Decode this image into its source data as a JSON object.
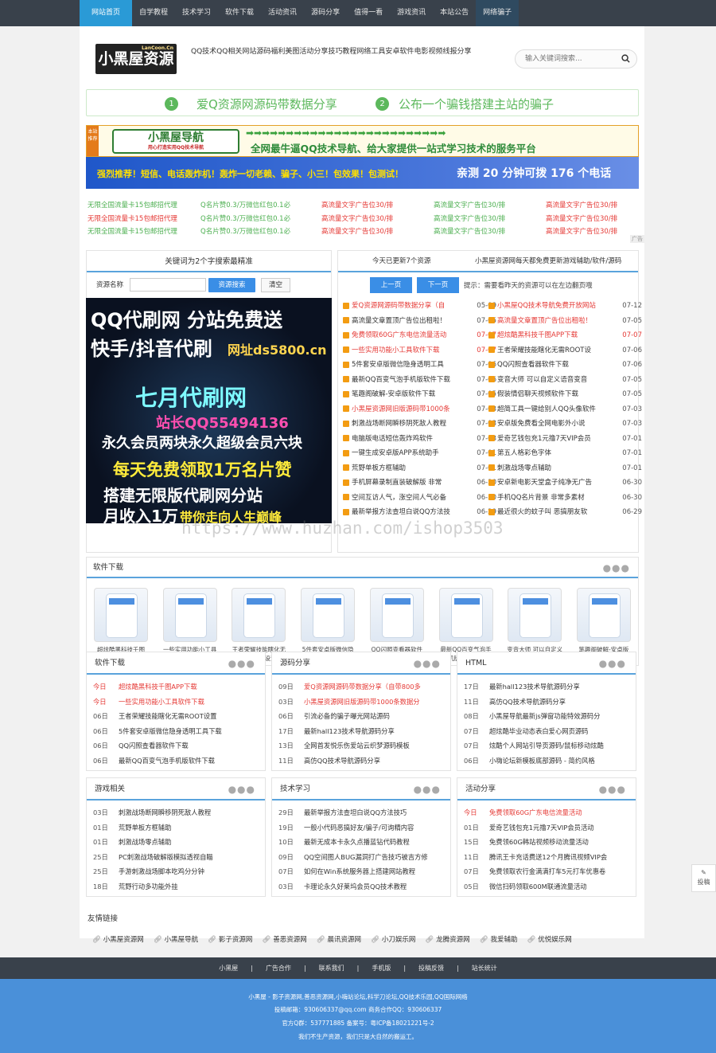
{
  "topnav": [
    {
      "label": "网站首页",
      "active": true
    },
    {
      "label": "自学教程",
      "dropdown": true
    },
    {
      "label": "技术学习",
      "dropdown": true
    },
    {
      "label": "软件下载",
      "dropdown": true
    },
    {
      "label": "活动资讯",
      "dropdown": true
    },
    {
      "label": "源码分享",
      "dropdown": true
    },
    {
      "label": "值得一看",
      "dropdown": true
    },
    {
      "label": "游戏资讯",
      "dropdown": true
    },
    {
      "label": "本站公告"
    },
    {
      "label": "网络骗子",
      "highlight": true
    }
  ],
  "logo": {
    "main": "小黑屋资源站",
    "sub": "LanCoon.Cn"
  },
  "header_links": [
    "QQ技术",
    "QQ相关",
    "网站源码",
    "福利美图",
    "活动分享",
    "技巧教程",
    "网络工具",
    "安卓软件",
    "电影视频",
    "线报分享"
  ],
  "search": {
    "placeholder": "输入关键词搜索..."
  },
  "notice": {
    "n1": "1",
    "t1": "爱Q资源网源码带数据分享",
    "n2": "2",
    "t2": "公布一个骗钱搭建主站的骗子"
  },
  "ad1": {
    "tag": "本站推荐",
    "logo": "小黑屋导航",
    "logo_sub": "用心打造实用QQ技术导航",
    "text": "全网最牛逼QQ技术导航、给大家提供一站式学习技术的服务平台"
  },
  "ad2": {
    "left": "强烈推荐！短信、电话轰炸机！轰炸一切老赖、骗子、小三！包效果！包测试！",
    "right": "亲测 20 分钟可拨 176 个电话"
  },
  "text_ads": [
    [
      "无限全国流量卡15包邮招代理",
      "Q名片赞0.3/万微信红包0.1必",
      "高流量文字广告位30/排",
      "高流量文字广告位30/排",
      "高流量文字广告位30/排"
    ],
    [
      "无限全国流量卡15包邮招代理",
      "Q名片赞0.3/万微信红包0.1必",
      "高流量文字广告位30/排",
      "高流量文字广告位30/排",
      "高流量文字广告位30/排"
    ],
    [
      "无限全国流量卡15包邮招代理",
      "Q名片赞0.3/万微信红包0.1必",
      "高流量文字广告位30/排",
      "高流量文字广告位30/排",
      "高流量文字广告位30/排"
    ]
  ],
  "ad_tag": "广告",
  "keyword_box": {
    "title": "关键词为2个字搜索最精准",
    "label": "资源名称",
    "search_btn": "资源搜索",
    "clear_btn": "清空"
  },
  "big_ad": {
    "l1": "QQ代刷网  分站免费送",
    "l2": "快手/抖音代刷",
    "l2b": "网址ds5800.cn",
    "l3": "七月代刷网",
    "l4": "站长QQ55494136",
    "l5": "永久会员两块永久超级会员六块",
    "l6": "每天免费领取1万名片赞",
    "l7": "搭建无限版代刷网分站",
    "l8": "月收入1万",
    "l8b": "带你走向人生巅峰"
  },
  "updates": {
    "today": "今天已更新7个资源",
    "slogan": "小黑屋资源网每天都免费更新游戏辅助/软件/源码",
    "prev": "上一页",
    "next": "下一页",
    "tip": "提示：需要看昨天的资源可以在左边翻页哦",
    "left": [
      [
        "爱Q资源网源码带数据分享（自",
        "05-09",
        true
      ],
      [
        "高流量文章置顶广告位出租啦！",
        "07-05",
        false
      ],
      [
        "免费领取60G广东电信流量活动",
        "07-07",
        true
      ],
      [
        "一些实用功能小工具软件下载",
        "07-07",
        true
      ],
      [
        "5件套安卓版微信隐身透明工具",
        "07-06",
        false
      ],
      [
        "最新QQ百变气泡手机版软件下载",
        "07-06",
        false
      ],
      [
        "笔趣阁破解-安卓版软件下载",
        "07-05",
        false
      ],
      [
        "小黑屋资源网旧版源码带1000条",
        "07-03",
        true
      ],
      [
        "刺激战场断网瞬移阴死敌人教程",
        "07-03",
        false
      ],
      [
        "电脑版电话短信轰炸鸡软件",
        "07-03",
        false
      ],
      [
        "一键生成安卓版APP系统助手",
        "07-01",
        false
      ],
      [
        "荒野单板方框辅助",
        "07-01",
        false
      ],
      [
        "手机屏幕录制直装破解版 非常",
        "06-30",
        false
      ],
      [
        "空间互访人气，涨空间人气必备",
        "06-30",
        false
      ],
      [
        "最新举报方法查坦白说QQ方法技",
        "06-29",
        false
      ]
    ],
    "right": [
      [
        "小黑屋QQ技术导航免费开放网站",
        "07-12",
        true
      ],
      [
        "高流量文章置顶广告位出租啦！",
        "07-05",
        true
      ],
      [
        "超炫酷黑科技千图APP下载",
        "07-07",
        true
      ],
      [
        "王者荣耀技能瞎化无需ROOT设",
        "07-06",
        false
      ],
      [
        "QQ闪照查看器软件下载",
        "07-06",
        false
      ],
      [
        "变音大师 可以自定义语音变音",
        "07-05",
        false
      ],
      [
        "假装情侣聊天视频软件下载",
        "07-05",
        false
      ],
      [
        "超简工具一键给别人QQ头像软件",
        "07-03",
        false
      ],
      [
        "安卓版免费看全网电影外小说",
        "07-03",
        false
      ],
      [
        "爱奇艺钱包充1元撸7天VIP会员",
        "07-01",
        false
      ],
      [
        "第五人格彩色字体",
        "07-01",
        false
      ],
      [
        "刺激战场零点辅助",
        "07-01",
        false
      ],
      [
        "安卓新电影天堂盒子纯净无广告",
        "06-30",
        false
      ],
      [
        "手机QQ名片背景 非常多素材",
        "06-30",
        false
      ],
      [
        "最近很火的蚊子叫 恶搞朋友软",
        "06-29",
        false
      ]
    ]
  },
  "watermark": "https://www.huzhan.com/ishop3503",
  "soft": {
    "title": "软件下载",
    "dots": "●●●",
    "items": [
      "超炫酷黑科技千图APP下载",
      "一些实用功能小工具软件下载",
      "王者荣耀技能瞎化无需ROOT设置",
      "5件套安卓版微信隐身透明工具下",
      "QQ闪照查看器软件下载",
      "最新QQ百变气泡手机版软件下载",
      "变音大师 可以自定义语音变音",
      "笔趣阁破解-安卓版软件下载"
    ]
  },
  "columns": [
    {
      "title": "软件下载",
      "rows": [
        [
          "今日",
          "超炫酷黑科技千图APP下载",
          true
        ],
        [
          "今日",
          "一些实用功能小工具软件下载",
          true
        ],
        [
          "06日",
          "王者荣耀技能瞎化无需ROOT设置",
          false
        ],
        [
          "06日",
          "5件套安卓版微信隐身透明工具下载",
          false
        ],
        [
          "06日",
          "QQ闪照查看器软件下载",
          false
        ],
        [
          "06日",
          "最新QQ百变气泡手机版软件下载",
          false
        ]
      ]
    },
    {
      "title": "源码分享",
      "rows": [
        [
          "09日",
          "爱Q资源网源码带数据分享（自带800多",
          true
        ],
        [
          "03日",
          "小黑屋资源网旧版源码带1000条数据分",
          true
        ],
        [
          "06日",
          "引流必备的骗子曝光网站源码",
          false
        ],
        [
          "17日",
          "最新hall123技术导航源码分享",
          false
        ],
        [
          "13日",
          "全网首发悦乐伤爱站云织梦源码模板",
          false
        ],
        [
          "11日",
          "高仿QQ技术导航源码分享",
          false
        ]
      ]
    },
    {
      "title": "HTML",
      "rows": [
        [
          "17日",
          "最新hall123技术导航源码分享",
          false
        ],
        [
          "11日",
          "高仿QQ技术导航源码分享",
          false
        ],
        [
          "08日",
          "小黑屋导航最新js弹窗功能特效源码分",
          false
        ],
        [
          "07日",
          "超炫酷毕业动态表白爱心网页源码",
          false
        ],
        [
          "07日",
          "炫酷个人网站引导页源码/鼠标移动炫酷",
          false
        ],
        [
          "06日",
          "小嗨论坛新模板底部源码 - 简约风格",
          false
        ]
      ]
    },
    {
      "title": "游戏相关",
      "rows": [
        [
          "03日",
          "刺激战场断网瞬移阴死敌人教程",
          false
        ],
        [
          "01日",
          "荒野单板方框辅助",
          false
        ],
        [
          "01日",
          "刺激战场零点辅助",
          false
        ],
        [
          "25日",
          "PC刺激战场破解版模拟透视自瞄",
          false
        ],
        [
          "25日",
          "手游刺激战场脚本吃鸡分分钟",
          false
        ],
        [
          "18日",
          "荒野行动多功能外挂",
          false
        ]
      ]
    },
    {
      "title": "技术学习",
      "rows": [
        [
          "29日",
          "最新举报方法查坦白说QQ方法技巧",
          false
        ],
        [
          "19日",
          "一般小代码恶搞好友/骗子/可询精内容",
          false
        ],
        [
          "10日",
          "最新无成本卡永久点播蓝钻代码教程",
          false
        ],
        [
          "09日",
          "QQ空间图人BUG漏洞打广告技巧被吉方修",
          false
        ],
        [
          "07日",
          "如何在Win系统服务器上搭建网站教程",
          false
        ],
        [
          "03日",
          "卡理论永久好莱坞会员QQ技术教程",
          false
        ]
      ]
    },
    {
      "title": "活动分享",
      "rows": [
        [
          "今日",
          "免费领取60G广东电信流量活动",
          true
        ],
        [
          "01日",
          "爱奇艺钱包充1元撸7天VIP会员活动",
          false
        ],
        [
          "15日",
          "免费领60G韩站视频移动流量活动",
          false
        ],
        [
          "11日",
          "腾讯王卡充话费送12个月腾讯视频VIP会",
          false
        ],
        [
          "07日",
          "免费领取农行金满满打车5元打车优惠卷",
          false
        ],
        [
          "05日",
          "微信扫码领取600M联通流量活动",
          false
        ]
      ]
    }
  ],
  "friends": {
    "title": "友情链接",
    "links": [
      "小黑屋资源网",
      "小黑屋导航",
      "影子资源网",
      "善恶资源网",
      "晨讯资源网",
      "小刀娱乐网",
      "龙腾资源网",
      "我爱辅助",
      "优悦娱乐网"
    ]
  },
  "footer_nav": [
    "小黑屋",
    "广告合作",
    "联系我们",
    "手机版",
    "投稿反馈",
    "站长统计"
  ],
  "footer": {
    "l1": "小黑屋 - 影子资源网,善恶资源网,小嗨站论坛,科学刀论坛,QQ技术乐园,QQ国际网络",
    "l2": "投稿邮箱：930606337@qq.com  商务合作QQ：930606337",
    "l3": "官方Q群：537771885  备案号：粤ICP备18021221号-2",
    "l4": "我们不生产资源，我们只是大自然的搬运工。"
  },
  "side": {
    "label": "投稿"
  }
}
